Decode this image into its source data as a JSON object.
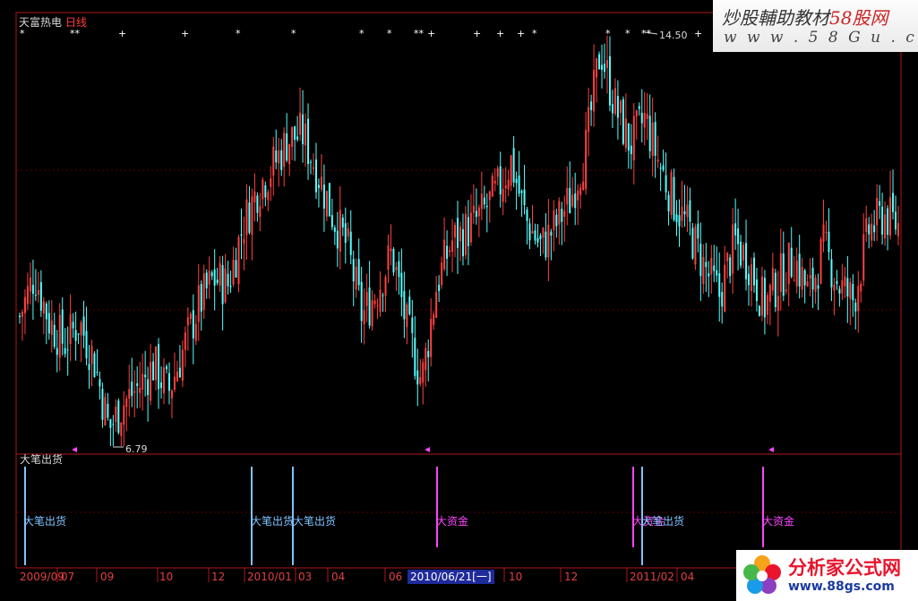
{
  "chart_header": {
    "stock_name": "天富热电",
    "period": "日线"
  },
  "price_labels": {
    "high": "14.50",
    "low": "6.79"
  },
  "indicator": {
    "name": "大笔出货",
    "signals": [
      {
        "date": "2009/10",
        "label": "大笔出货",
        "kind": "sell"
      },
      {
        "date": "2010/02",
        "label": "大笔出货",
        "kind": "sell"
      },
      {
        "date": "2010/03",
        "label": "大笔出货",
        "kind": "sell"
      },
      {
        "date": "2010/06",
        "label": "大资金",
        "kind": "buy"
      },
      {
        "date": "2011/01",
        "label": "大资金",
        "kind": "buy"
      },
      {
        "date": "2011/01",
        "label": "大笔出货",
        "kind": "sell"
      },
      {
        "date": "2011/06",
        "label": "大资金",
        "kind": "buy"
      }
    ]
  },
  "x_axis": {
    "ticks": [
      "2009/09",
      "07",
      "09",
      "10",
      "12",
      "2010/01",
      "03",
      "04",
      "06",
      "10",
      "12",
      "2011/02",
      "04"
    ],
    "cursor_label": "2010/06/21[一]"
  },
  "chart_data": {
    "type": "candlestick",
    "series": [
      {
        "name": "天富热电",
        "start": "2009-09",
        "end": "2011-07",
        "close_path": [
          9.2,
          10.0,
          9.1,
          8.7,
          9.1,
          8.4,
          7.1,
          7.6,
          7.9,
          8.3,
          7.8,
          8.6,
          9.4,
          9.9,
          9.8,
          10.9,
          11.6,
          12.0,
          12.5,
          12.6,
          11.9,
          11.1,
          10.5,
          9.2,
          9.7,
          10.4,
          9.0,
          8.0,
          9.8,
          10.6,
          10.8,
          11.1,
          11.5,
          12.1,
          11.0,
          10.5,
          10.9,
          11.4,
          12.3,
          14.2,
          13.1,
          12.4,
          12.9,
          12.0,
          11.3,
          10.8,
          10.1,
          9.6,
          10.6,
          10.2,
          9.4,
          9.9,
          10.3,
          9.6,
          10.5,
          9.8,
          9.5,
          10.8,
          11.1,
          10.9
        ],
        "high": 14.5,
        "low": 6.79
      }
    ],
    "top_markers": [
      "*",
      "**",
      "+",
      "+",
      "*",
      "*",
      "*",
      "*",
      "**",
      "+",
      "+",
      "+",
      "+",
      "*",
      "*"
    ],
    "colors": {
      "up": "#ff4040",
      "down": "#54ffff",
      "grid": "#7a0000",
      "axis": "#b01818"
    }
  },
  "watermarks": {
    "top_title": "炒股輔助教材",
    "top_brand": "58股网",
    "top_url": "w w w . 5 8 G u . c o m",
    "bottom_title": "分析家公式网",
    "bottom_url": "www.88gs.com"
  }
}
